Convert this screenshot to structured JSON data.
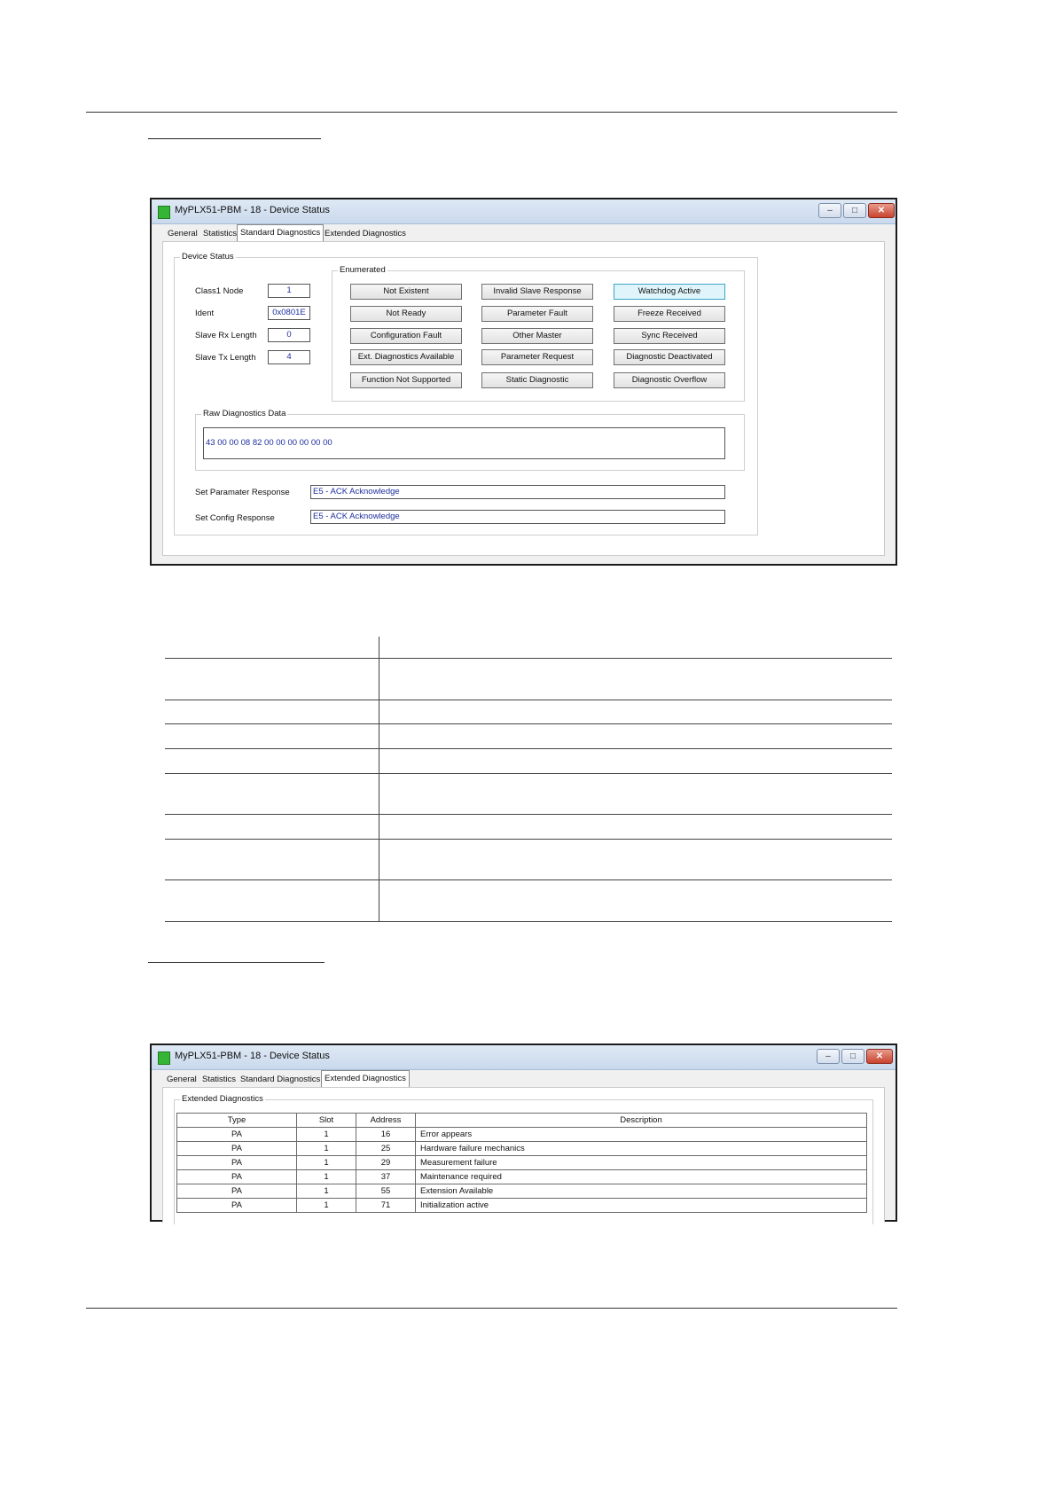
{
  "window1": {
    "title": "MyPLX51-PBM - 18 - Device Status",
    "tabs": [
      "General",
      "Statistics",
      "Standard Diagnostics",
      "Extended Diagnostics"
    ],
    "active_tab": "Standard Diagnostics",
    "device_status_label": "Device Status",
    "fields": [
      {
        "label": "Class1 Node",
        "value": "1"
      },
      {
        "label": "Ident",
        "value": "0x0801E"
      },
      {
        "label": "Slave Rx Length",
        "value": "0"
      },
      {
        "label": "Slave Tx Length",
        "value": "4"
      }
    ],
    "enumerated_label": "Enumerated",
    "enumerated_buttons": [
      "Not Existent",
      "Invalid Slave Response",
      "Watchdog Active",
      "Not Ready",
      "Parameter Fault",
      "Freeze Received",
      "Configuration Fault",
      "Other Master",
      "Sync Received",
      "Ext. Diagnostics Available",
      "Parameter Request",
      "Diagnostic Deactivated",
      "Function Not Supported",
      "Static Diagnostic",
      "Diagnostic Overflow"
    ],
    "active_flag": "Watchdog Active",
    "raw_diag_label": "Raw Diagnostics Data",
    "raw_diag_value": "43 00 00 08 82 00 00 00 00 00 00",
    "set_param_label": "Set Paramater Response",
    "set_param_value": "E5 - ACK Acknowledge",
    "set_config_label": "Set Config Response",
    "set_config_value": "E5 - ACK Acknowledge"
  },
  "window2": {
    "title": "MyPLX51-PBM - 18 - Device Status",
    "tabs": [
      "General",
      "Statistics",
      "Standard Diagnostics",
      "Extended Diagnostics"
    ],
    "active_tab": "Extended Diagnostics",
    "group_label": "Extended Diagnostics",
    "columns": [
      "Type",
      "Slot",
      "Address",
      "Description"
    ],
    "rows": [
      [
        "PA",
        "1",
        "16",
        "Error appears"
      ],
      [
        "PA",
        "1",
        "25",
        "Hardware failure mechanics"
      ],
      [
        "PA",
        "1",
        "29",
        "Measurement failure"
      ],
      [
        "PA",
        "1",
        "37",
        "Maintenance required"
      ],
      [
        "PA",
        "1",
        "55",
        "Extension Available"
      ],
      [
        "PA",
        "1",
        "71",
        "Initialization active"
      ]
    ]
  },
  "colors": {
    "status_green": "#35b535",
    "value_blue": "#1d2f9e",
    "active_flag_bg": "#dff5fb"
  }
}
